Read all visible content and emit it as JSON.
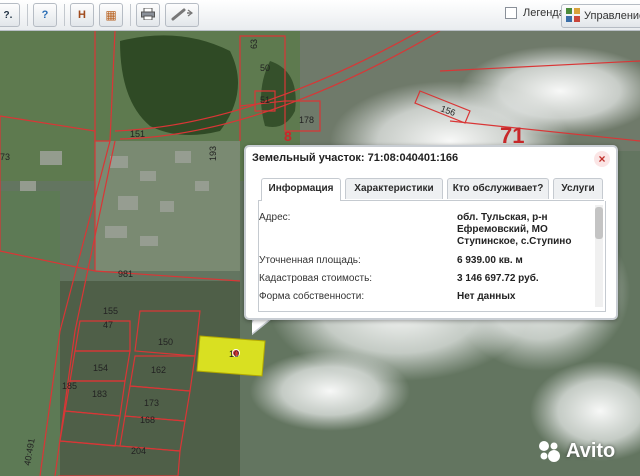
{
  "toolbar": {
    "buttons": [
      {
        "name": "identify-icon",
        "glyph": "?."
      },
      {
        "name": "map-info-icon",
        "glyph": "?"
      },
      {
        "name": "measure-icon",
        "glyph": "H"
      },
      {
        "name": "building-icon",
        "glyph": "▦"
      },
      {
        "name": "print-icon",
        "glyph": "🖶"
      },
      {
        "name": "link-icon",
        "glyph": "⛓"
      }
    ],
    "legend_label": "Легенда",
    "manage_label": "Управление картой"
  },
  "map": {
    "labels": [
      "63",
      "50",
      "51",
      "178",
      "8",
      "71",
      "156",
      "73",
      "151",
      "193",
      "981",
      "155",
      "47",
      "150",
      "154",
      "162",
      "185",
      "183",
      "173",
      "168",
      "204",
      "40:491",
      "10"
    ]
  },
  "popup": {
    "title": "Земельный участок: 71:08:040401:166",
    "close_glyph": "×",
    "tabs": [
      "Информация",
      "Характеристики",
      "Кто обслуживает?",
      "Услуги"
    ],
    "rows": [
      {
        "label": "Адрес:",
        "value_lines": [
          "обл. Тульская, р-н",
          "Ефремовский, МО",
          "Ступинское, с.Ступино"
        ]
      },
      {
        "label": "Уточненная площадь:",
        "value_lines": [
          "6 939.00 кв. м"
        ]
      },
      {
        "label": "Кадастровая стоимость:",
        "value_lines": [
          "3 146 697.72 руб."
        ]
      },
      {
        "label": "Форма собственности:",
        "value_lines": [
          "Нет данных"
        ]
      }
    ]
  },
  "watermark": "Avito",
  "colors": {
    "parcel_line": "#d93636",
    "selected_parcel": "#d9e021",
    "popup_border": "#c8cdd3"
  }
}
